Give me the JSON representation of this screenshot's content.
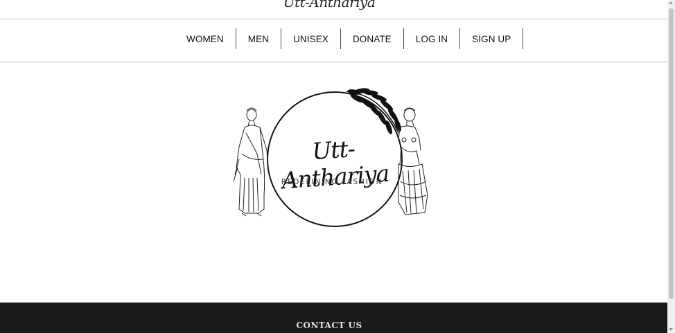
{
  "header": {
    "brand": "Utt-Anthariya"
  },
  "nav": {
    "items": [
      {
        "label": "WOMEN"
      },
      {
        "label": "MEN"
      },
      {
        "label": "UNISEX"
      },
      {
        "label": "DONATE"
      },
      {
        "label": "LOG IN"
      },
      {
        "label": "SIGN UP"
      }
    ]
  },
  "hero": {
    "logo_title": "Utt-Anthariya",
    "logo_tagline": "REDEFINING FASHION",
    "logo_icons": [
      "woman-statue-icon",
      "laurel-branch-icon",
      "venus-statue-icon"
    ]
  },
  "footer": {
    "heading": "CONTACT US"
  },
  "colors": {
    "background": "#ffffff",
    "footer": "#1b1b1b",
    "text": "#111111"
  }
}
